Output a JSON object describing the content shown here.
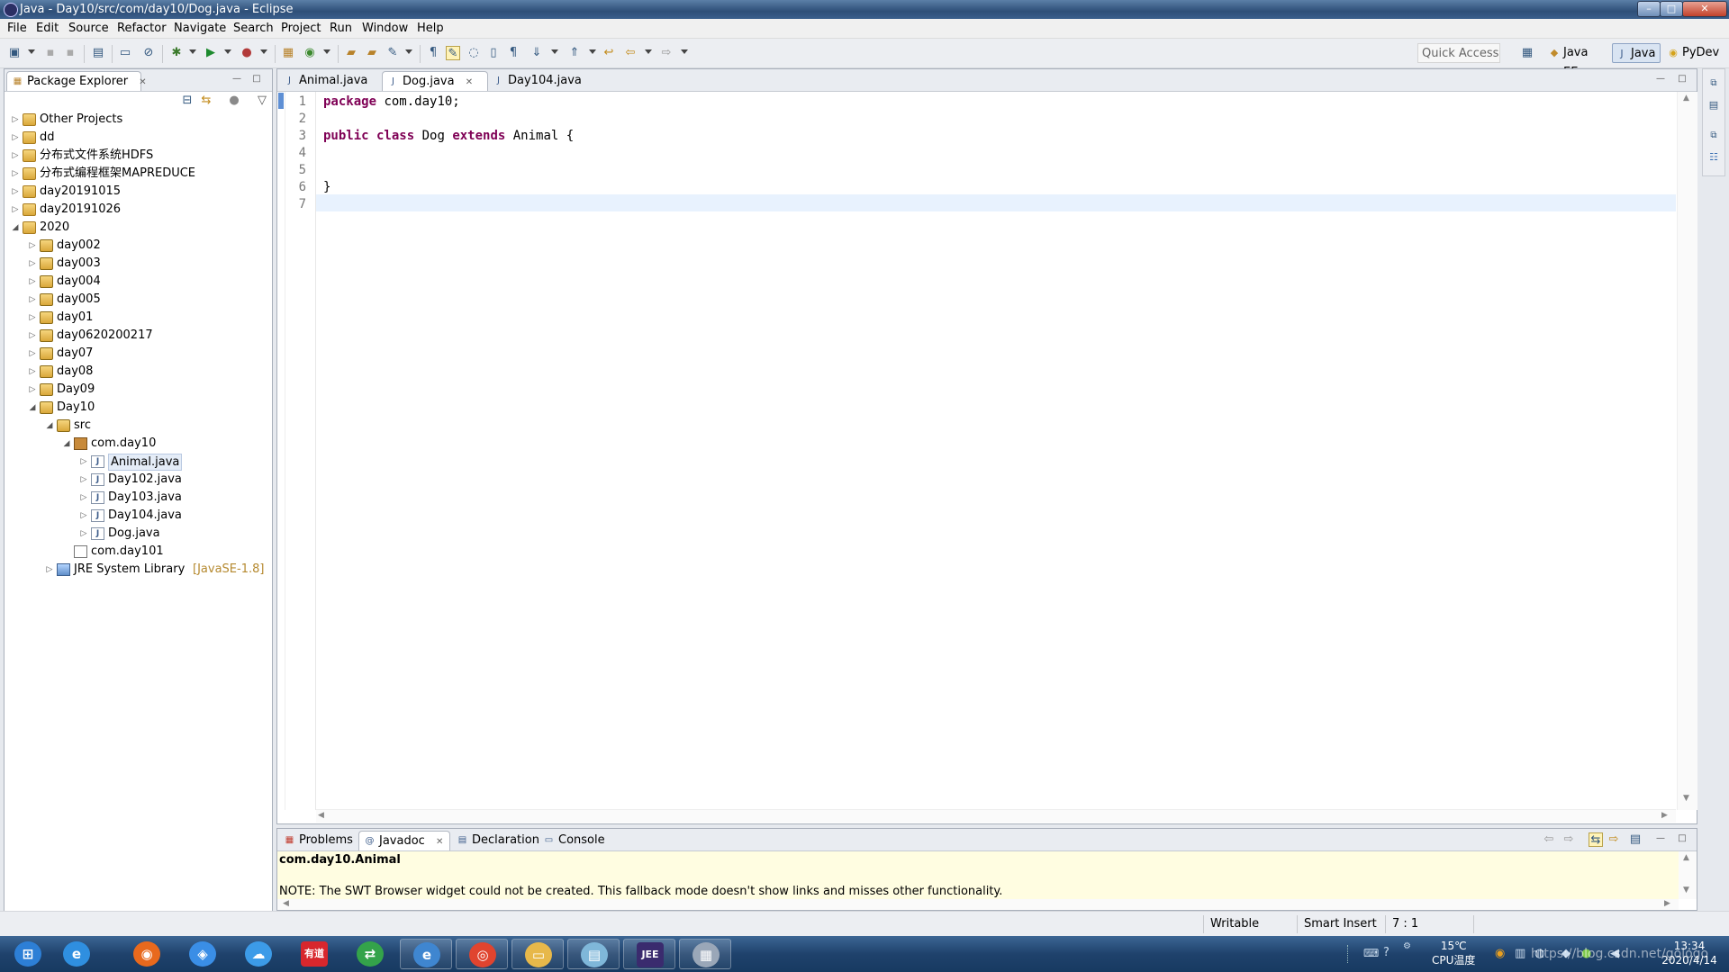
{
  "window": {
    "title": "Java - Day10/src/com/day10/Dog.java - Eclipse",
    "controls": {
      "minimize": "–",
      "maximize": "□",
      "close": "✕"
    }
  },
  "menu": [
    "File",
    "Edit",
    "Source",
    "Refactor",
    "Navigate",
    "Search",
    "Project",
    "Run",
    "Window",
    "Help"
  ],
  "toolbar": {
    "quick_access_placeholder": "Quick Access",
    "perspectives": [
      {
        "label": "Java EE",
        "icon": "java-ee-perspective-icon"
      },
      {
        "label": "Java",
        "icon": "java-perspective-icon",
        "active": true
      },
      {
        "label": "PyDev",
        "icon": "pydev-perspective-icon"
      }
    ]
  },
  "package_explorer": {
    "title": "Package Explorer",
    "tree": [
      {
        "label": "Other Projects",
        "depth": 0,
        "expanded": false,
        "icon": "working-set"
      },
      {
        "label": "dd",
        "depth": 0,
        "expanded": false,
        "icon": "working-set"
      },
      {
        "label": "分布式文件系统HDFS",
        "depth": 0,
        "expanded": false,
        "icon": "working-set"
      },
      {
        "label": "分布式编程框架MAPREDUCE",
        "depth": 0,
        "expanded": false,
        "icon": "working-set"
      },
      {
        "label": "day20191015",
        "depth": 0,
        "expanded": false,
        "icon": "working-set"
      },
      {
        "label": "day20191026",
        "depth": 0,
        "expanded": false,
        "icon": "working-set"
      },
      {
        "label": "2020",
        "depth": 0,
        "expanded": true,
        "icon": "working-set"
      },
      {
        "label": "day002",
        "depth": 1,
        "expanded": false,
        "icon": "project"
      },
      {
        "label": "day003",
        "depth": 1,
        "expanded": false,
        "icon": "project"
      },
      {
        "label": "day004",
        "depth": 1,
        "expanded": false,
        "icon": "project"
      },
      {
        "label": "day005",
        "depth": 1,
        "expanded": false,
        "icon": "project"
      },
      {
        "label": "day01",
        "depth": 1,
        "expanded": false,
        "icon": "project"
      },
      {
        "label": "day0620200217",
        "depth": 1,
        "expanded": false,
        "icon": "project"
      },
      {
        "label": "day07",
        "depth": 1,
        "expanded": false,
        "icon": "project"
      },
      {
        "label": "day08",
        "depth": 1,
        "expanded": false,
        "icon": "project"
      },
      {
        "label": "Day09",
        "depth": 1,
        "expanded": false,
        "icon": "project"
      },
      {
        "label": "Day10",
        "depth": 1,
        "expanded": true,
        "icon": "project"
      },
      {
        "label": "src",
        "depth": 2,
        "expanded": true,
        "icon": "source-folder"
      },
      {
        "label": "com.day10",
        "depth": 3,
        "expanded": true,
        "icon": "package"
      },
      {
        "label": "Animal.java",
        "depth": 4,
        "expanded": false,
        "icon": "java-file",
        "selected": true
      },
      {
        "label": "Day102.java",
        "depth": 4,
        "expanded": false,
        "icon": "java-file"
      },
      {
        "label": "Day103.java",
        "depth": 4,
        "expanded": false,
        "icon": "java-file"
      },
      {
        "label": "Day104.java",
        "depth": 4,
        "expanded": false,
        "icon": "java-file"
      },
      {
        "label": "Dog.java",
        "depth": 4,
        "expanded": false,
        "icon": "java-file"
      },
      {
        "label": "com.day101",
        "depth": 3,
        "expanded": null,
        "icon": "empty-package"
      },
      {
        "label": "JRE System Library",
        "suffix": "[JavaSE-1.8]",
        "depth": 2,
        "expanded": false,
        "icon": "library"
      }
    ]
  },
  "editor": {
    "tabs": [
      {
        "label": "Animal.java",
        "active": false
      },
      {
        "label": "Dog.java",
        "active": true
      },
      {
        "label": "Day104.java",
        "active": false
      }
    ],
    "lines": [
      {
        "num": "1",
        "kw": "package",
        "rest": " com.day10;"
      },
      {
        "num": "2",
        "kw": "",
        "rest": ""
      },
      {
        "num": "3",
        "kw": "public class",
        "rest": " Dog ",
        "kw2": "extends",
        "rest2": " Animal {"
      },
      {
        "num": "4",
        "kw": "",
        "rest": ""
      },
      {
        "num": "5",
        "kw": "",
        "rest": ""
      },
      {
        "num": "6",
        "kw": "",
        "rest": "}"
      },
      {
        "num": "7",
        "kw": "",
        "rest": ""
      }
    ]
  },
  "bottom_panel": {
    "tabs": [
      {
        "label": "Problems",
        "active": false
      },
      {
        "label": "Javadoc",
        "active": true
      },
      {
        "label": "Declaration",
        "active": false
      },
      {
        "label": "Console",
        "active": false
      }
    ],
    "javadoc_title": "com.day10.Animal",
    "javadoc_note": "NOTE: The SWT Browser widget could not be created. This fallback mode doesn't show links and misses other functionality."
  },
  "status": {
    "writable": "Writable",
    "insert_mode": "Smart Insert",
    "position": "7 : 1"
  },
  "taskbar": {
    "apps": [
      {
        "name": "start-button",
        "glyph": "⊞",
        "color": "#2d7fd6"
      },
      {
        "name": "ie-icon",
        "glyph": "e",
        "color": "#2f8fe0"
      },
      {
        "name": "firefox-icon",
        "glyph": "◉",
        "color": "#e8691d"
      },
      {
        "name": "baidu-netdisk-icon",
        "glyph": "◈",
        "color": "#3a8ee6"
      },
      {
        "name": "cloud-icon",
        "glyph": "☁",
        "color": "#3c9be8"
      },
      {
        "name": "youdao-icon",
        "glyph": "有道",
        "color": "#d8272d"
      },
      {
        "name": "green-app-icon",
        "glyph": "⇄",
        "color": "#34a34a"
      },
      {
        "name": "ie2-icon",
        "glyph": "e",
        "color": "#3f86d0"
      },
      {
        "name": "chrome-icon",
        "glyph": "◎",
        "color": "#e0442f"
      },
      {
        "name": "explorer-icon",
        "glyph": "▭",
        "color": "#e7b84a"
      },
      {
        "name": "notepad-icon",
        "glyph": "▤",
        "color": "#7fb7d9"
      },
      {
        "name": "eclipse-icon",
        "glyph": "JEE",
        "color": "#3a2b6e"
      },
      {
        "name": "calculator-icon",
        "glyph": "▦",
        "color": "#9aa7b8"
      }
    ],
    "weather_temp": "15℃",
    "weather_label": "CPU温度",
    "time": "13:34",
    "date": "2020/4/14",
    "watermark": "https://blog.csdn.net/gologo"
  }
}
